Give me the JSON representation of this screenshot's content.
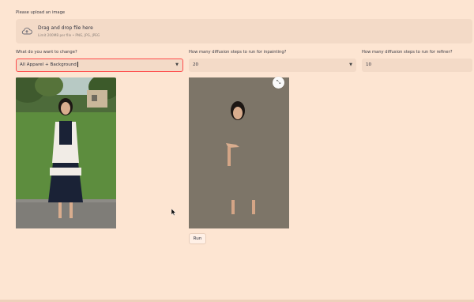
{
  "uploader": {
    "label": "Please upload an image",
    "title": "Drag and drop file here",
    "hint": "Limit 200MB per file • PNG, JPG, JPEG",
    "icon": "cloud-upload-icon"
  },
  "controls": {
    "change": {
      "label": "What do you want to change?",
      "value": "All Apparel + Background"
    },
    "steps": {
      "label": "How many diffusion steps to run for inpainting?",
      "value": "20"
    },
    "refine": {
      "label": "How many diffusion steps to run for refiner?",
      "value": "10"
    }
  },
  "images": {
    "original": "photo of a woman in a white jacket and navy dress on grass",
    "result": "inpainted result with gray background"
  },
  "result_toolbar": {
    "expand_icon": "expand-icon"
  },
  "actions": {
    "run_label": "Run"
  },
  "colors": {
    "background": "#fde5d2",
    "input_bg": "#f3dac7",
    "focus_border": "#ff4b4b"
  }
}
